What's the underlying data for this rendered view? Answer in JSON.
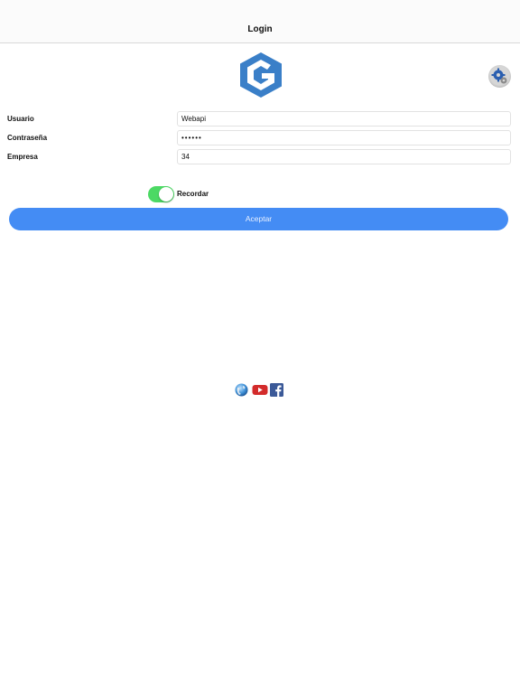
{
  "navbar": {
    "title": "Login"
  },
  "logo": {
    "name": "g-hexagon-logo",
    "color": "#3a7fc8"
  },
  "settings": {
    "icon": "gears-icon"
  },
  "form": {
    "usuario_label": "Usuario",
    "usuario_value": "Webapi",
    "password_label": "Contraseña",
    "password_value": "••••••",
    "empresa_label": "Empresa",
    "empresa_value": "34"
  },
  "remember": {
    "label": "Recordar",
    "checked": true,
    "color": "#4cd964"
  },
  "accept_button": {
    "label": "Aceptar",
    "color": "#448cf4"
  },
  "social_links": [
    {
      "icon": "globe-icon"
    },
    {
      "icon": "youtube-icon",
      "color": "#d32b2b"
    },
    {
      "icon": "facebook-icon",
      "color": "#3b5998"
    }
  ]
}
